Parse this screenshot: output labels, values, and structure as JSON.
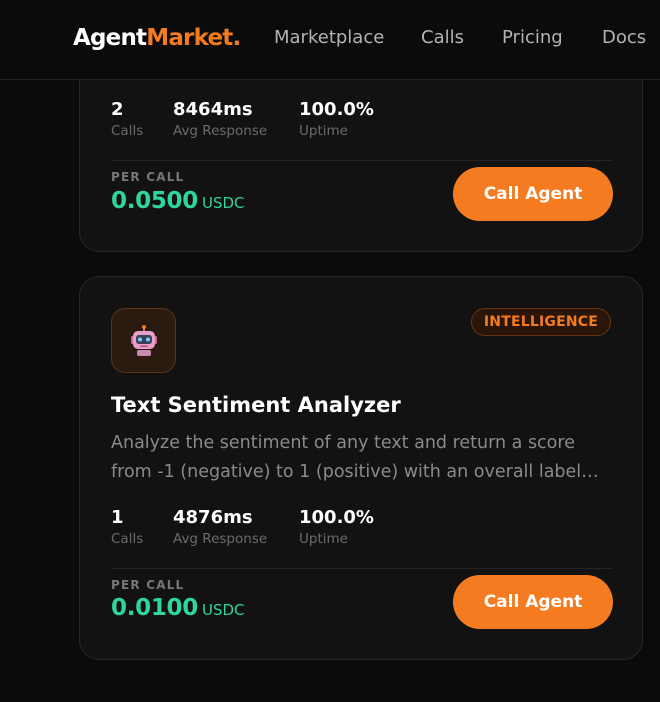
{
  "header": {
    "logo_primary": "Agent",
    "logo_accent": "Market",
    "logo_dot": ".",
    "nav": [
      {
        "label": "Marketplace"
      },
      {
        "label": "Calls"
      },
      {
        "label": "Pricing"
      },
      {
        "label": "Docs"
      }
    ]
  },
  "colors": {
    "accent": "#f47b20",
    "price": "#2ed69b",
    "background": "#0b0b0b",
    "card": "#121212"
  },
  "cards": [
    {
      "stats": [
        {
          "value": "2",
          "label": "Calls"
        },
        {
          "value": "8464ms",
          "label": "Avg Response"
        },
        {
          "value": "100.0%",
          "label": "Uptime"
        }
      ],
      "per_call_label": "PER CALL",
      "price": "0.0500",
      "currency": "USDC",
      "button_label": "Call Agent"
    },
    {
      "icon": "robot-icon",
      "category": "INTELLIGENCE",
      "title": "Text Sentiment Analyzer",
      "description": "Analyze the sentiment of any text and return a score from -1 (negative) to 1 (positive) with an overall label and confidence.",
      "stats": [
        {
          "value": "1",
          "label": "Calls"
        },
        {
          "value": "4876ms",
          "label": "Avg Response"
        },
        {
          "value": "100.0%",
          "label": "Uptime"
        }
      ],
      "per_call_label": "PER CALL",
      "price": "0.0100",
      "currency": "USDC",
      "button_label": "Call Agent"
    }
  ]
}
